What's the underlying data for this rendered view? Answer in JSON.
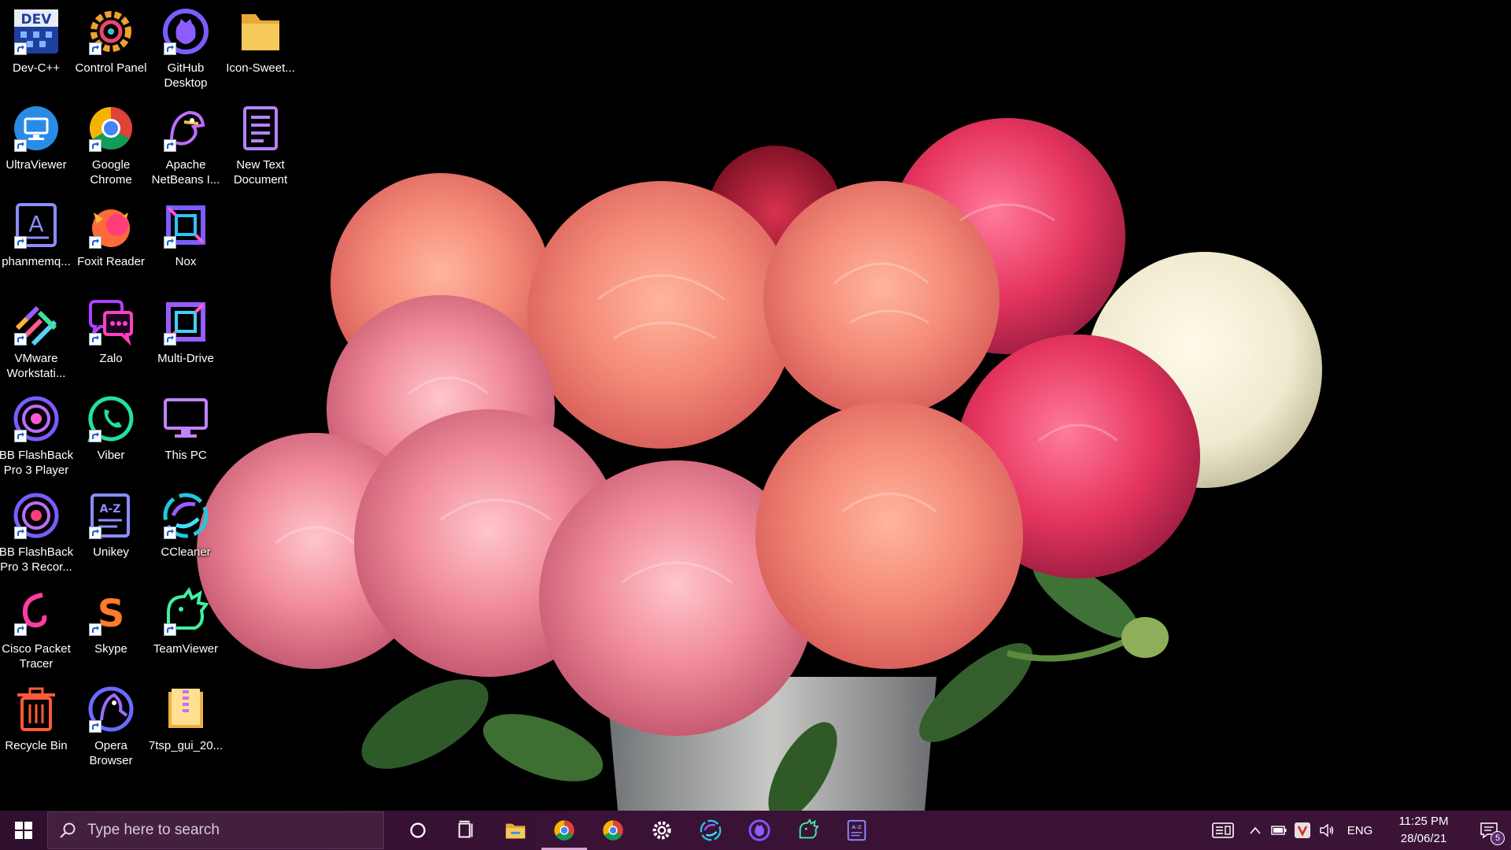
{
  "desktop": {
    "icons": [
      {
        "label": "Dev-C++",
        "icon": "devcpp-icon"
      },
      {
        "label": "Control Panel",
        "icon": "control-panel-icon"
      },
      {
        "label": "GitHub\nDesktop",
        "icon": "github-icon"
      },
      {
        "label": "Icon-Sweet...",
        "icon": "folder-icon"
      },
      {
        "label": "UltraViewer",
        "icon": "ultraviewer-icon"
      },
      {
        "label": "Google\nChrome",
        "icon": "chrome-icon"
      },
      {
        "label": "Apache\nNetBeans I...",
        "icon": "netbeans-icon"
      },
      {
        "label": "New Text\nDocument",
        "icon": "text-document-icon"
      },
      {
        "label": "phanmemq...",
        "icon": "text-app-icon"
      },
      {
        "label": "Foxit Reader",
        "icon": "foxit-icon"
      },
      {
        "label": "Nox",
        "icon": "nox-icon"
      },
      {
        "label": "VMware\nWorkstati...",
        "icon": "vmware-icon"
      },
      {
        "label": "Zalo",
        "icon": "zalo-icon"
      },
      {
        "label": "Multi-Drive",
        "icon": "multi-drive-icon"
      },
      {
        "label": "BB FlashBack\nPro 3 Player",
        "icon": "flashback-player-icon"
      },
      {
        "label": "Viber",
        "icon": "viber-icon"
      },
      {
        "label": "This PC",
        "icon": "this-pc-icon"
      },
      {
        "label": "BB FlashBack\nPro 3 Recor...",
        "icon": "flashback-recorder-icon"
      },
      {
        "label": "Unikey",
        "icon": "unikey-icon"
      },
      {
        "label": "CCleaner",
        "icon": "ccleaner-icon"
      },
      {
        "label": "Cisco Packet\nTracer",
        "icon": "cisco-icon"
      },
      {
        "label": "Skype",
        "icon": "skype-icon"
      },
      {
        "label": "TeamViewer",
        "icon": "teamviewer-icon"
      },
      {
        "label": "Recycle Bin",
        "icon": "recycle-bin-icon"
      },
      {
        "label": "Opera\nBrowser",
        "icon": "opera-icon"
      },
      {
        "label": "7tsp_gui_20...",
        "icon": "archive-icon"
      }
    ]
  },
  "taskbar": {
    "search_placeholder": "Type here to search",
    "pinned": [
      {
        "icon": "cortana-icon"
      },
      {
        "icon": "task-view-icon"
      },
      {
        "icon": "file-explorer-icon"
      },
      {
        "icon": "chrome-icon",
        "active": true
      },
      {
        "icon": "chrome-icon"
      },
      {
        "icon": "settings-gear-icon"
      },
      {
        "icon": "ccleaner-icon"
      },
      {
        "icon": "github-icon"
      },
      {
        "icon": "teamviewer-icon"
      },
      {
        "icon": "unikey-icon"
      }
    ],
    "tray": {
      "language": "ENG",
      "time": "11:25 PM",
      "date": "28/06/21",
      "notification_count": "5"
    }
  },
  "colors": {
    "taskbar": "#3a1236",
    "accent": "#c86cff"
  }
}
